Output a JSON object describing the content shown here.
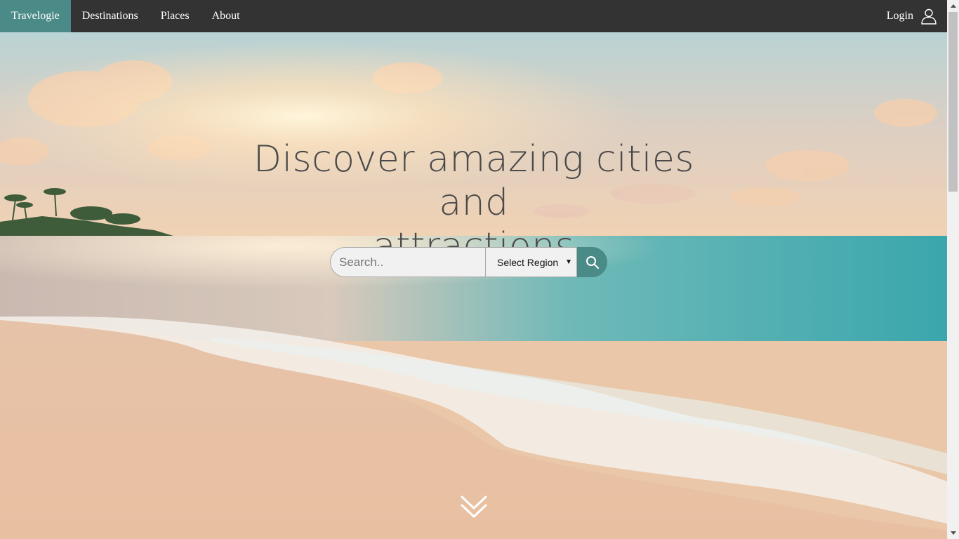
{
  "navbar": {
    "brand": "Travelogie",
    "links": [
      "Destinations",
      "Places",
      "About"
    ],
    "login_label": "Login",
    "login_icon": "user-icon",
    "background": "#333333",
    "brand_background": "#4a8a87"
  },
  "hero": {
    "background_scene": "beach-sunset",
    "title_line1": "Discover amazing cities and",
    "title_line2": "attractions",
    "title_color": "#4a4a4a"
  },
  "search": {
    "placeholder": "Search..",
    "value": "",
    "region_selected": "Select Region",
    "button_icon": "search-icon",
    "accent": "#4a8a87"
  },
  "scroll_down_icon": "double-chevron-down-icon"
}
